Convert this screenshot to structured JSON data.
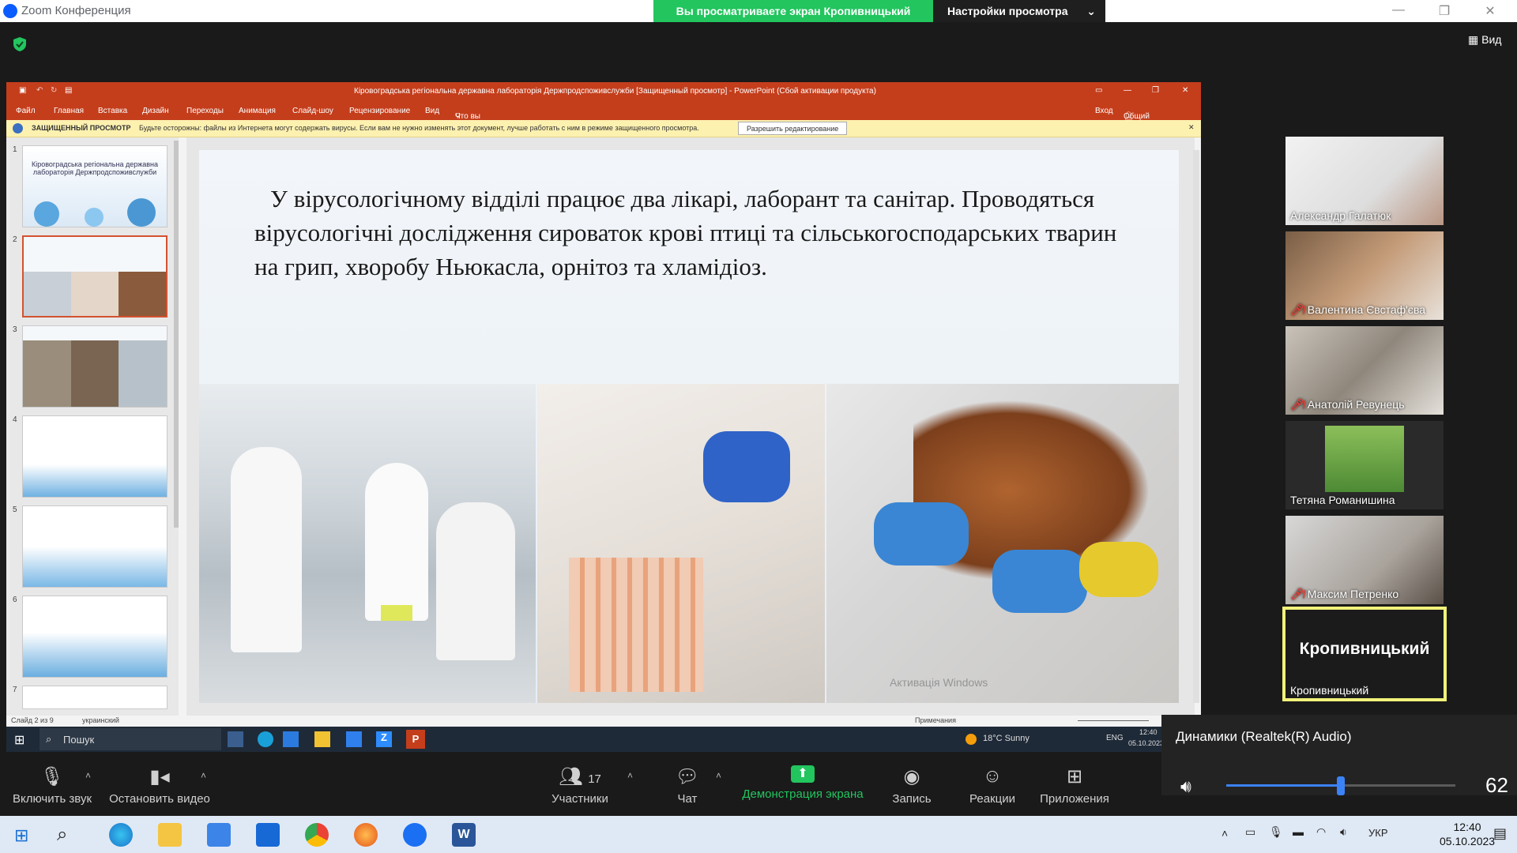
{
  "zoom": {
    "window_title": "Zoom Конференция",
    "share_banner": "Вы просматриваете экран Кропивницький",
    "view_settings": "Настройки просмотра",
    "view_button": "Вид"
  },
  "ppt": {
    "title": "Кіровоградська регіональна державна лабораторія Держпродспоживслужби [Защищенный просмотр] - PowerPoint (Сбой активации продукта)",
    "menu": [
      "Файл",
      "Главная",
      "Вставка",
      "Дизайн",
      "Переходы",
      "Анимация",
      "Слайд-шоу",
      "Рецензирование",
      "Вид"
    ],
    "tell_me": "Что вы хотите сделать?",
    "login": "Вход",
    "share": "Общий доступ",
    "protected_label": "ЗАЩИЩЕННЫЙ ПРОСМОТР",
    "protected_text": "Будьте осторожны: файлы из Интернета могут содержать вирусы. Если вам не нужно изменять этот документ, лучше работать с ним в режиме защищенного просмотра.",
    "enable_editing": "Разрешить редактирование",
    "thumb_numbers": [
      "1",
      "2",
      "3",
      "4",
      "5",
      "6",
      "7"
    ],
    "thumb1_text": "Кіровоградська регіональна державна лабораторія Держпродспоживслужби",
    "slide_text": "У вірусологічному відділі працює два лікарі, лаборант та санітар. Проводяться вірусологічні дослідження сироваток крові птиці та сільськогосподарських тварин на грип, хворобу Ньюкасла, орнітоз та хламідіоз.",
    "watermark": "Активація Windows",
    "status_slide": "Слайд 2 из 9",
    "status_lang": "украинский",
    "status_notes": "Примечания"
  },
  "inner_taskbar": {
    "search": "Пошук",
    "weather": "18°C  Sunny",
    "lang": "ENG",
    "time": "12:40",
    "date": "05.10.2023"
  },
  "participants": [
    {
      "name": "Александр Галатюк",
      "muted": false
    },
    {
      "name": "Валентина Євстаф'єва",
      "muted": true
    },
    {
      "name": "Анатолій Ревунець",
      "muted": true
    },
    {
      "name": "Тетяна Романишина",
      "muted": false
    },
    {
      "name": "Максим Петренко",
      "muted": true
    }
  ],
  "self_tile": {
    "big_name": "Кропивницький",
    "name": "Кропивницький"
  },
  "audio": {
    "device": "Динамики (Realtek(R) Audio)",
    "volume": 62,
    "volume_fraction": 0.5
  },
  "controls": {
    "unmute": "Включить звук",
    "stop_video": "Остановить видео",
    "participants": "Участники",
    "participants_count": "17",
    "chat": "Чат",
    "share": "Демонстрация экрана",
    "record": "Запись",
    "reactions": "Реакции",
    "apps": "Приложения"
  },
  "taskbar": {
    "lang": "УКР",
    "time": "12:40",
    "date": "05.10.2023"
  }
}
